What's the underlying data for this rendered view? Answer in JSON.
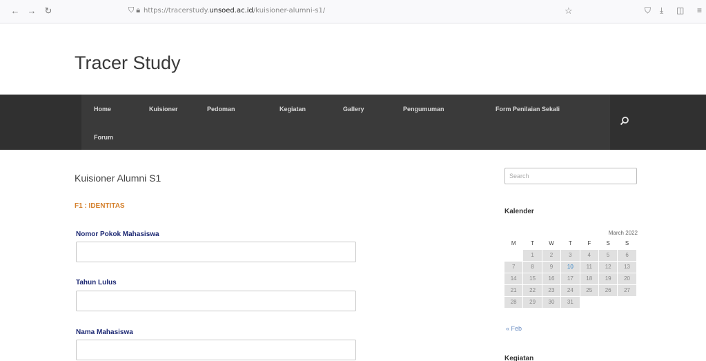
{
  "browser": {
    "back": "←",
    "forward": "→",
    "reload": "↻",
    "url_prefix": "https://tracerstudy.",
    "url_domain": "unsoed.ac.id",
    "url_path": "/kuisioner-alumni-s1/",
    "star": "☆",
    "right_icons": [
      "⛉",
      "⤓",
      "◫",
      "≡"
    ]
  },
  "site": {
    "title": "Tracer Study"
  },
  "nav": {
    "items": [
      "Home",
      "Kuisioner",
      "Pedoman",
      "Kegiatan",
      "Gallery",
      "Pengumuman",
      "Form Penilaian Sekali",
      "Forum"
    ]
  },
  "main": {
    "page_title": "Kuisioner Alumni S1",
    "section": "F1 : IDENTITAS",
    "fields": [
      {
        "label": "Nomor Pokok Mahasiswa",
        "value": ""
      },
      {
        "label": "Tahun Lulus",
        "value": ""
      },
      {
        "label": "Nama Mahasiswa",
        "value": ""
      }
    ]
  },
  "sidebar": {
    "search_placeholder": "Search",
    "calendar_title": "Kalender",
    "month": "March 2022",
    "weekdays": [
      "M",
      "T",
      "W",
      "T",
      "F",
      "S",
      "S"
    ],
    "weeks": [
      [
        "",
        "1",
        "2",
        "3",
        "4",
        "5",
        "6"
      ],
      [
        "7",
        "8",
        "9",
        "10",
        "11",
        "12",
        "13"
      ],
      [
        "14",
        "15",
        "16",
        "17",
        "18",
        "19",
        "20"
      ],
      [
        "21",
        "22",
        "23",
        "24",
        "25",
        "26",
        "27"
      ],
      [
        "28",
        "29",
        "30",
        "31",
        "",
        "",
        ""
      ]
    ],
    "today": "10",
    "prev_link": "« Feb",
    "next_section": "Kegiatan"
  }
}
